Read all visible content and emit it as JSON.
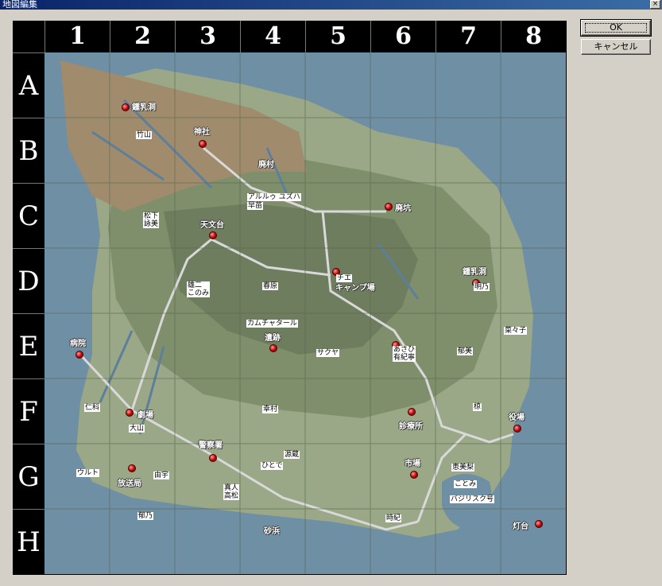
{
  "window": {
    "title": "地図編集",
    "close_label": "×"
  },
  "buttons": {
    "ok_label": "OK",
    "cancel_label": "キャンセル"
  },
  "grid": {
    "columns": [
      "1",
      "2",
      "3",
      "4",
      "5",
      "6",
      "7",
      "8"
    ],
    "rows": [
      "A",
      "B",
      "C",
      "D",
      "E",
      "F",
      "G",
      "H"
    ]
  },
  "places": {
    "cave_ab": "鍾乳洞",
    "shrine": "神社",
    "abandoned_village": "廃村",
    "abandoned_mine": "廃坑",
    "observatory": "天文台",
    "camp": "キャンプ場",
    "cave_d": "鍾乳洞",
    "ruins": "遺跡",
    "hospital": "病院",
    "theater": "劇場",
    "clinic": "診療所",
    "town_hall": "役場",
    "police": "警察署",
    "market": "市場",
    "broadcast": "放送局",
    "beach": "砂浜",
    "lighthouse": "灯台"
  },
  "labels": {
    "takeyama": "竹山",
    "alruu_yuzuha": "アルルゥ ユズハ",
    "sanae": "早苗",
    "matsushita_eimi": "松下\n詠美",
    "chie": "チエ",
    "akino": "明乃",
    "nanako": "菜々子",
    "yukiji_konomi": "雄二\nこのみ",
    "haruhara": "春原",
    "kamuchatyaru": "カムチャタール",
    "sakuya": "サクヤ",
    "asahi_yukiko": "あさひ\n有紀寧",
    "ikumi": "郁美",
    "nishina": "仁科",
    "oyama": "大山",
    "kotetsu": "幸村",
    "ryo": "椋",
    "genji": "源蔵",
    "hitoko": "ひとで",
    "emiri": "恵美梨",
    "kotomi": "ことみ",
    "basilisk": "バジリスク号",
    "ultu": "ウルト",
    "yuzu": "由宇",
    "makoto_takamatsu": "真人\n高松",
    "ikuno": "郁乃",
    "toki": "時紀"
  }
}
